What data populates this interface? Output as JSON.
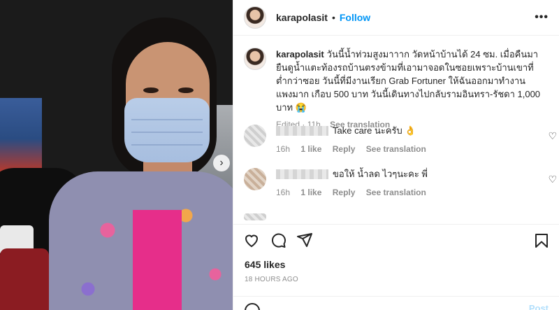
{
  "post": {
    "username": "karapolasit",
    "follow_label": "Follow",
    "separator": "•",
    "more_label": "•••",
    "caption_text": "วันนี้น้ำท่วมสูงมาาาก วัดหน้าบ้านได้ 24 ซม. เมื่อคืนมายืนดูน้ำแตะท้องรถบ้านตรงข้ามที่เอามาจอดในซอยเพราะบ้านเขาที่ต่ำกว่าซอย วันนี้ที่มีงานเรียก Grab Fortuner ให้ฉันออกมาทำงาน แพงมาก เกือบ 500 บาท วันนี้เดินทางไปกลับรามอินทรา-รัชดา 1,000 บาท 😭",
    "caption_meta": "Edited · 11h",
    "see_translation": "See translation",
    "likes": "645 likes",
    "posted_time": "18 HOURS AGO",
    "add_comment_post": "Post"
  },
  "comments": [
    {
      "text": "Take care นะครับ 👌",
      "age": "16h",
      "likes": "1 like",
      "reply": "Reply",
      "translate": "See translation"
    },
    {
      "text": "ขอให้ น้ำลด ไวๆนะคะ พี่",
      "age": "16h",
      "likes": "1 like",
      "reply": "Reply",
      "translate": "See translation"
    }
  ],
  "partial_comment": {
    "hearts": "♥ ♥"
  },
  "icons": {
    "like": "heart-outline-icon",
    "comment": "speech-bubble-icon",
    "share": "paper-plane-icon",
    "save": "bookmark-icon",
    "next": "chevron-right-icon",
    "comment_like": "small-heart-icon",
    "emoji": "emoji-icon"
  },
  "colors": {
    "follow": "#0095f6",
    "muted": "#8e8e8e",
    "text": "#262626",
    "divider": "#efefef"
  }
}
